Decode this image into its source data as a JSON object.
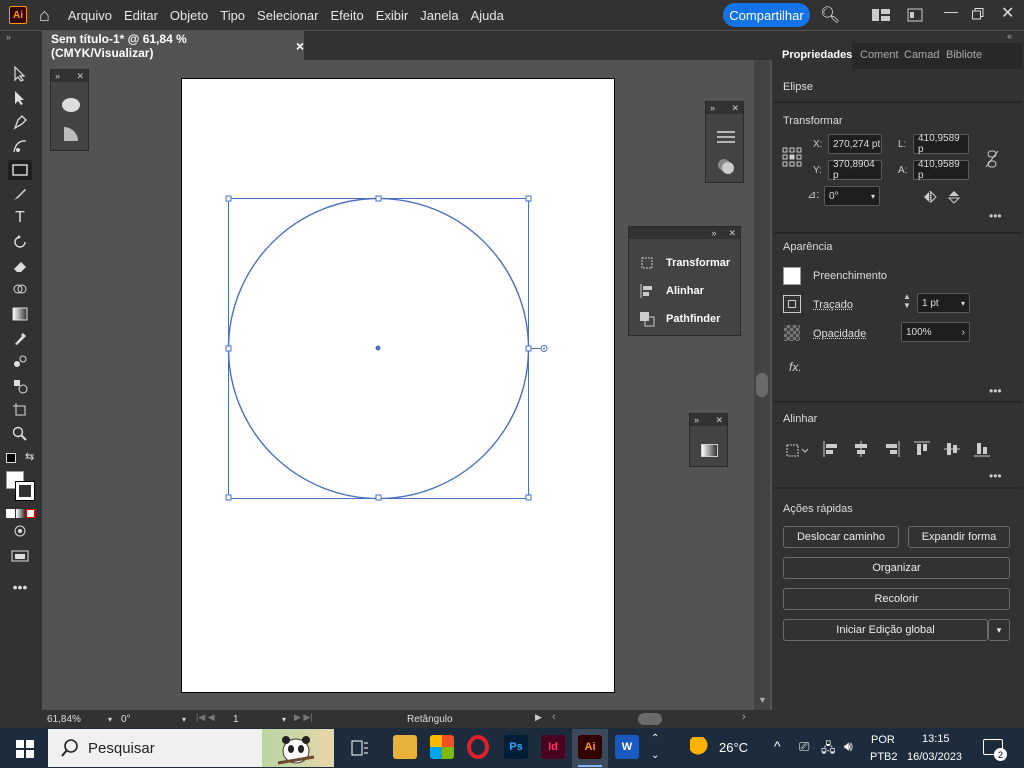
{
  "app": {
    "logo": "Ai"
  },
  "menu": [
    "Arquivo",
    "Editar",
    "Objeto",
    "Tipo",
    "Selecionar",
    "Efeito",
    "Exibir",
    "Janela",
    "Ajuda"
  ],
  "share_label": "Compartilhar",
  "doc_tab": {
    "title": "Sem título-1* @ 61,84 % (CMYK/Visualizar)",
    "close": "×"
  },
  "floating_panel": {
    "items": [
      "Transformar",
      "Alinhar",
      "Pathfinder"
    ]
  },
  "properties": {
    "tabs": [
      "Propriedades",
      "Coment",
      "Camad",
      "Bibliote"
    ],
    "object_type": "Elipse",
    "transform": {
      "title": "Transformar",
      "x_label": "X:",
      "x": "270,274 pt",
      "y_label": "Y:",
      "y": "370,8904 p",
      "w_label": "L:",
      "w": "410,9589 p",
      "h_label": "A:",
      "h": "410,9589 p",
      "angle": "0°"
    },
    "appearance": {
      "title": "Aparência",
      "fill_label": "Preenchimento",
      "stroke_label": "Traçado",
      "stroke_value": "1 pt",
      "opacity_label": "Opacidade",
      "opacity_value": "100%",
      "fx": "fx."
    },
    "align": {
      "title": "Alinhar"
    },
    "quick_actions": {
      "title": "Ações rápidas",
      "offset_path": "Deslocar caminho",
      "expand_shape": "Expandir forma",
      "arrange": "Organizar",
      "recolor": "Recolorir",
      "global_edit": "Iniciar Edição global"
    }
  },
  "status": {
    "zoom": "61,84%",
    "rotation": "0°",
    "artboard": "1",
    "tool": "Retângulo"
  },
  "taskbar": {
    "search": "Pesquisar",
    "weather": "26°C",
    "lang1": "POR",
    "lang2": "PTB2",
    "time": "13:15",
    "date": "16/03/2023",
    "notifications": "2"
  },
  "colors": {
    "accent": "#1473e6",
    "selection": "#4a6fbf",
    "ui_dark": "#323232",
    "canvas": "#535353"
  }
}
